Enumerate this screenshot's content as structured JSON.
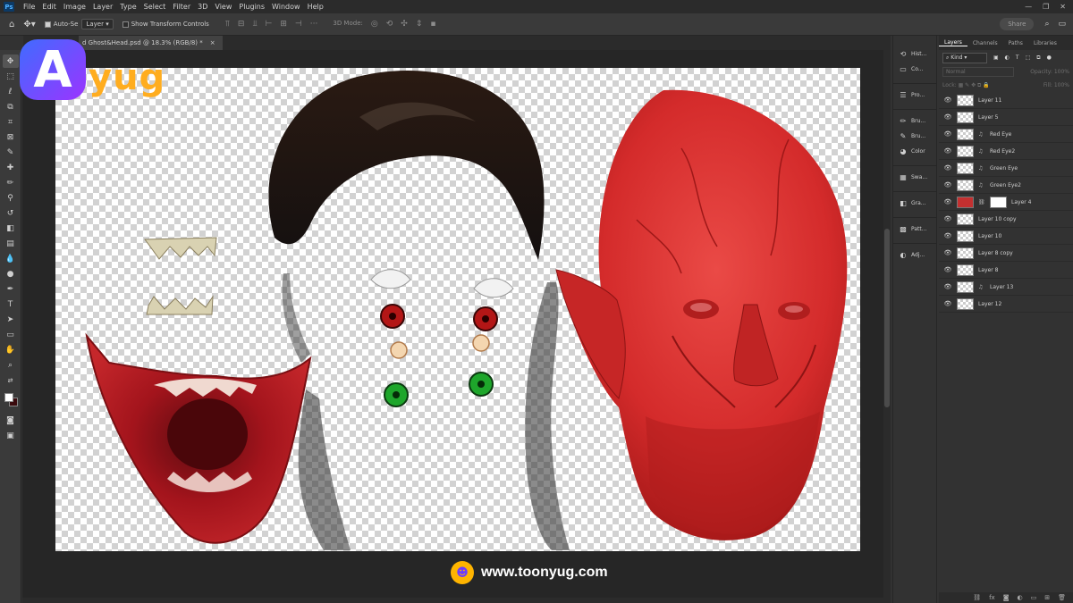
{
  "menu": [
    "File",
    "Edit",
    "Image",
    "Layer",
    "Type",
    "Select",
    "Filter",
    "3D",
    "View",
    "Plugins",
    "Window",
    "Help"
  ],
  "app_logo": "Ps",
  "window_controls": [
    "—",
    "❐",
    "✕"
  ],
  "options": {
    "auto_select": "Auto-Se",
    "target": "Layer",
    "show_transform": "Show Transform Controls",
    "mode_3d": "3D Mode:",
    "share": "Share"
  },
  "document": {
    "tab_title": "d Ghost&Head.psd @ 18.3% (RGB/8) *",
    "close": "×"
  },
  "collapsed_panels": [
    {
      "label": "Hist...",
      "icon": "history-icon"
    },
    {
      "label": "Co...",
      "icon": "comments-icon"
    },
    {
      "label": "Pro...",
      "icon": "properties-icon"
    },
    {
      "label": "Bru...",
      "icon": "brush-icon"
    },
    {
      "label": "Bru...",
      "icon": "brush-settings-icon"
    },
    {
      "label": "Color",
      "icon": "color-icon"
    },
    {
      "label": "Swa...",
      "icon": "swatches-icon"
    },
    {
      "label": "Gra...",
      "icon": "gradients-icon"
    },
    {
      "label": "Patt...",
      "icon": "patterns-icon"
    },
    {
      "label": "Adj...",
      "icon": "adjustments-icon"
    }
  ],
  "layers_panel": {
    "tabs": [
      "Layers",
      "Channels",
      "Paths",
      "Libraries"
    ],
    "kind": "Kind",
    "blend_mode": "Normal",
    "opacity_label": "Opacity:",
    "opacity_value": "100%",
    "lock_label": "Lock:",
    "fill_label": "Fill:",
    "fill_value": "100%",
    "layers": [
      {
        "name": "Layer 11",
        "smart": false,
        "mask": false
      },
      {
        "name": "Layer 5",
        "smart": false,
        "mask": false
      },
      {
        "name": "Red Eye",
        "smart": true,
        "mask": false
      },
      {
        "name": "Red Eye2",
        "smart": true,
        "mask": false
      },
      {
        "name": "Green Eye",
        "smart": true,
        "mask": false
      },
      {
        "name": "Green Eye2",
        "smart": true,
        "mask": false
      },
      {
        "name": "Layer 4",
        "smart": false,
        "mask": true
      },
      {
        "name": "Layer 10 copy",
        "smart": false,
        "mask": false
      },
      {
        "name": "Layer 10",
        "smart": false,
        "mask": false
      },
      {
        "name": "Layer 8 copy",
        "smart": false,
        "mask": false
      },
      {
        "name": "Layer 8",
        "smart": false,
        "mask": false
      },
      {
        "name": "Layer 13",
        "smart": true,
        "mask": false
      },
      {
        "name": "Layer 12",
        "smart": false,
        "mask": false
      }
    ]
  },
  "watermark": {
    "logo_letter": "A",
    "logo_rest": "yug"
  },
  "footer_url": "www.toonyug.com",
  "colors": {
    "foreground": "#ffffff",
    "background": "#3a0b0e",
    "head_red": "#d42b2b"
  }
}
